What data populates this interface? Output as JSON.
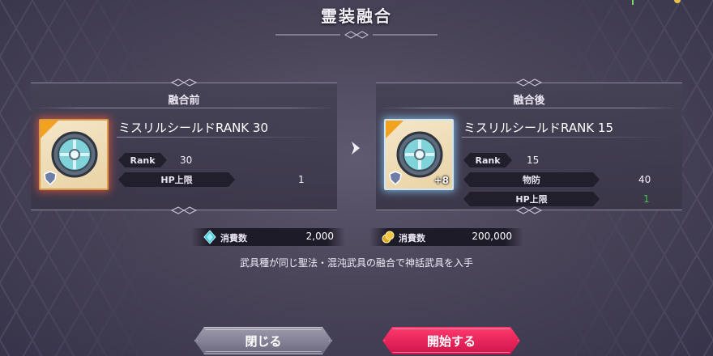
{
  "header": {
    "title": "霊装融合"
  },
  "before": {
    "heading": "融合前",
    "item_name": "ミスリルシールドRANK 30",
    "stats": [
      {
        "label": "Rank",
        "value": "30"
      },
      {
        "label": "HP上限",
        "value": "1"
      }
    ],
    "icon": "shield-gem-icon",
    "frame_color": "#d99a4a"
  },
  "after": {
    "heading": "融合後",
    "item_name": "ミスリルシールドRANK 15",
    "plus": "+8",
    "stats": [
      {
        "label": "Rank",
        "value": "15"
      },
      {
        "label": "物防",
        "value": "40"
      },
      {
        "label": "HP上限",
        "value": "1"
      }
    ],
    "icon": "shield-gem-icon",
    "frame_color": "#cfe6f2",
    "highlight_color": "#3ec84a"
  },
  "costs": [
    {
      "label": "消費数",
      "value": "2,000",
      "icon": "crystal-icon"
    },
    {
      "label": "消費数",
      "value": "200,000",
      "icon": "gold-coin-icon"
    }
  ],
  "note": "武具種が同じ聖法・混沌武具の融合で神話武具を入手",
  "buttons": {
    "close": "閉じる",
    "start": "開始する"
  },
  "colors": {
    "accent": "#ff2d63",
    "background": "#4a4559"
  }
}
